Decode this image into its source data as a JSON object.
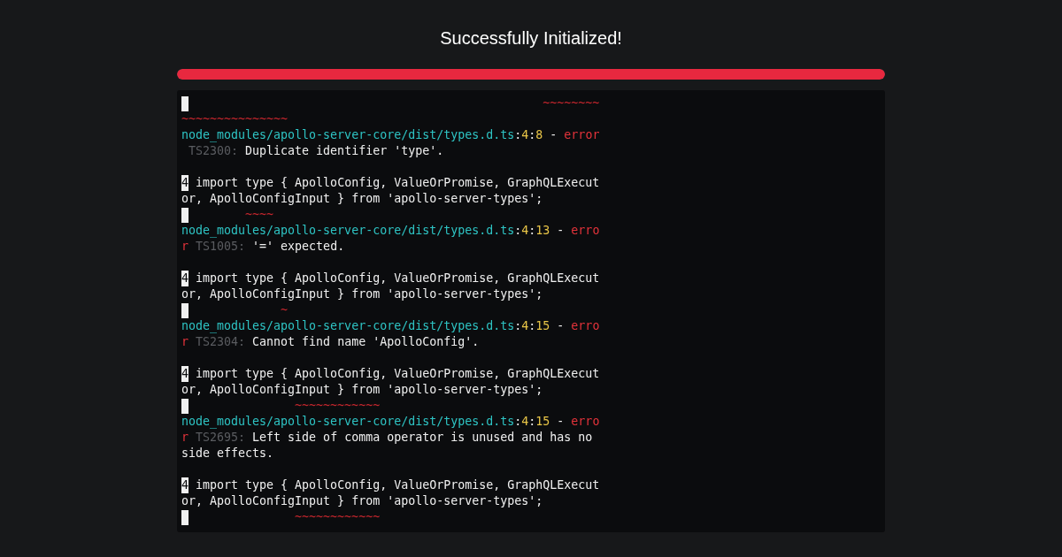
{
  "heading": "Successfully Initialized!",
  "progress": {
    "level": 1
  },
  "terminal": {
    "lines": [
      {
        "kind": "marker",
        "segments": [
          {
            "kind": "tilde",
            "text": "                                                  ~~~~~~~~"
          }
        ]
      },
      {
        "kind": "text",
        "segments": [
          {
            "kind": "tilde",
            "text": "~~~~~~~~~~~~~~~"
          }
        ]
      },
      {
        "kind": "text",
        "segments": [
          {
            "kind": "path",
            "text": "node_modules/apollo-server-core/dist/types.d.ts"
          },
          {
            "kind": "punct",
            "text": ":"
          },
          {
            "kind": "position",
            "text": "4"
          },
          {
            "kind": "punct",
            "text": ":"
          },
          {
            "kind": "position",
            "text": "8"
          },
          {
            "kind": "plain",
            "text": " - "
          },
          {
            "kind": "error",
            "text": "error"
          }
        ]
      },
      {
        "kind": "text",
        "segments": [
          {
            "kind": "code",
            "text": " TS2300:"
          },
          {
            "kind": "plain",
            "text": " Duplicate identifier 'type'."
          }
        ]
      },
      {
        "kind": "blank"
      },
      {
        "kind": "text",
        "segments": [
          {
            "kind": "gutter",
            "text": "4"
          },
          {
            "kind": "plain",
            "text": " import type { ApolloConfig, ValueOrPromise, GraphQLExecut"
          }
        ]
      },
      {
        "kind": "text",
        "segments": [
          {
            "kind": "plain",
            "text": "or, ApolloConfigInput } from 'apollo-server-types';"
          }
        ]
      },
      {
        "kind": "marker",
        "segments": [
          {
            "kind": "tilde",
            "text": "        ~~~~"
          }
        ]
      },
      {
        "kind": "text",
        "segments": [
          {
            "kind": "path",
            "text": "node_modules/apollo-server-core/dist/types.d.ts"
          },
          {
            "kind": "punct",
            "text": ":"
          },
          {
            "kind": "position",
            "text": "4"
          },
          {
            "kind": "punct",
            "text": ":"
          },
          {
            "kind": "position",
            "text": "13"
          },
          {
            "kind": "plain",
            "text": " - "
          },
          {
            "kind": "error",
            "text": "erro"
          }
        ]
      },
      {
        "kind": "text",
        "segments": [
          {
            "kind": "error",
            "text": "r"
          },
          {
            "kind": "code",
            "text": " TS1005:"
          },
          {
            "kind": "plain",
            "text": " '=' expected."
          }
        ]
      },
      {
        "kind": "blank"
      },
      {
        "kind": "text",
        "segments": [
          {
            "kind": "gutter",
            "text": "4"
          },
          {
            "kind": "plain",
            "text": " import type { ApolloConfig, ValueOrPromise, GraphQLExecut"
          }
        ]
      },
      {
        "kind": "text",
        "segments": [
          {
            "kind": "plain",
            "text": "or, ApolloConfigInput } from 'apollo-server-types';"
          }
        ]
      },
      {
        "kind": "marker",
        "segments": [
          {
            "kind": "tilde",
            "text": "             ~"
          }
        ]
      },
      {
        "kind": "text",
        "segments": [
          {
            "kind": "path",
            "text": "node_modules/apollo-server-core/dist/types.d.ts"
          },
          {
            "kind": "punct",
            "text": ":"
          },
          {
            "kind": "position",
            "text": "4"
          },
          {
            "kind": "punct",
            "text": ":"
          },
          {
            "kind": "position",
            "text": "15"
          },
          {
            "kind": "plain",
            "text": " - "
          },
          {
            "kind": "error",
            "text": "erro"
          }
        ]
      },
      {
        "kind": "text",
        "segments": [
          {
            "kind": "error",
            "text": "r"
          },
          {
            "kind": "code",
            "text": " TS2304:"
          },
          {
            "kind": "plain",
            "text": " Cannot find name 'ApolloConfig'."
          }
        ]
      },
      {
        "kind": "blank"
      },
      {
        "kind": "text",
        "segments": [
          {
            "kind": "gutter",
            "text": "4"
          },
          {
            "kind": "plain",
            "text": " import type { ApolloConfig, ValueOrPromise, GraphQLExecut"
          }
        ]
      },
      {
        "kind": "text",
        "segments": [
          {
            "kind": "plain",
            "text": "or, ApolloConfigInput } from 'apollo-server-types';"
          }
        ]
      },
      {
        "kind": "marker",
        "segments": [
          {
            "kind": "tilde",
            "text": "               ~~~~~~~~~~~~"
          }
        ]
      },
      {
        "kind": "text",
        "segments": [
          {
            "kind": "path",
            "text": "node_modules/apollo-server-core/dist/types.d.ts"
          },
          {
            "kind": "punct",
            "text": ":"
          },
          {
            "kind": "position",
            "text": "4"
          },
          {
            "kind": "punct",
            "text": ":"
          },
          {
            "kind": "position",
            "text": "15"
          },
          {
            "kind": "plain",
            "text": " - "
          },
          {
            "kind": "error",
            "text": "erro"
          }
        ]
      },
      {
        "kind": "text",
        "segments": [
          {
            "kind": "error",
            "text": "r"
          },
          {
            "kind": "code",
            "text": " TS2695:"
          },
          {
            "kind": "plain",
            "text": " Left side of comma operator is unused and has no"
          }
        ]
      },
      {
        "kind": "text",
        "segments": [
          {
            "kind": "plain",
            "text": "side effects."
          }
        ]
      },
      {
        "kind": "blank"
      },
      {
        "kind": "text",
        "segments": [
          {
            "kind": "gutter",
            "text": "4"
          },
          {
            "kind": "plain",
            "text": " import type { ApolloConfig, ValueOrPromise, GraphQLExecut"
          }
        ]
      },
      {
        "kind": "text",
        "segments": [
          {
            "kind": "plain",
            "text": "or, ApolloConfigInput } from 'apollo-server-types';"
          }
        ]
      },
      {
        "kind": "marker",
        "segments": [
          {
            "kind": "tilde",
            "text": "               ~~~~~~~~~~~~"
          }
        ]
      }
    ]
  }
}
